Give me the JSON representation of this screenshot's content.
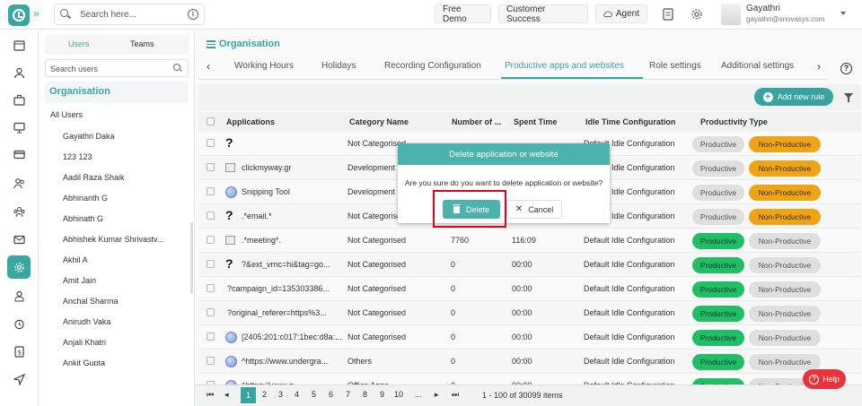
{
  "topbar": {
    "search_placeholder": "Search here...",
    "buttons": [
      "Free Demo",
      "Customer Success",
      "Agent"
    ],
    "user_name": "Gayathri",
    "user_email": "gayathri@snovasys.com"
  },
  "rail": {
    "icons": [
      "calendar-icon",
      "user-icon",
      "briefcase-icon",
      "monitor-icon",
      "card-icon",
      "users-icon",
      "team-icon",
      "mail-icon",
      "settings-icon",
      "person-icon",
      "alarm-icon",
      "invoice-icon",
      "send-icon"
    ],
    "active_index": 8
  },
  "user_panel": {
    "tabs": [
      "Users",
      "Teams"
    ],
    "active_tab": "Users",
    "search_placeholder": "Search users",
    "org_title": "Organisation",
    "all_users": "All Users",
    "users": [
      "Gayathri Daka",
      "123 123",
      "Aadil Raza Shaik",
      "Abhinanth G",
      "Abhinath G",
      "Abhishek Kumar Shrivastv...",
      "Akhil A",
      "Amit Jain",
      "Anchal Sharma",
      "Anirudh Vaka",
      "Anjali Khatri",
      "Ankit Gupta"
    ]
  },
  "main": {
    "page_title": "Organisation",
    "tabs": [
      "Working Hours",
      "Holidays",
      "Recording Configuration",
      "Productive apps and websites",
      "Role settings",
      "Additional settings"
    ],
    "active_tab": "Productive apps and websites",
    "add_rule_label": "Add new rule",
    "columns": [
      "Applications",
      "Category Name",
      "Number of ...",
      "Spent Time",
      "Idle Time Configuration",
      "Productivity Type"
    ],
    "rows": [
      {
        "icon": "question",
        "name": "",
        "category": "Not Categorised",
        "number": "",
        "spent": "",
        "idle": "Default Idle Configuration",
        "type": "non-productive"
      },
      {
        "icon": "image",
        "name": "clickmyway.gr",
        "category": "Development",
        "number": "",
        "spent": "",
        "idle": "Default Idle Configuration",
        "type": "non-productive"
      },
      {
        "icon": "globe",
        "name": "Snipping Tool",
        "category": "Development",
        "number": "",
        "spent": "",
        "idle": "Default Idle Configuration",
        "type": "non-productive"
      },
      {
        "icon": "question",
        "name": ".*email.*",
        "category": "Not Categorised",
        "number": "",
        "spent": "",
        "idle": "Default Idle Configuration",
        "type": "non-productive"
      },
      {
        "icon": "image",
        "name": ".*meeting*.",
        "category": "Not Categorised",
        "number": "7760",
        "spent": "116:09",
        "idle": "Default Idle Configuration",
        "type": "productive"
      },
      {
        "icon": "question",
        "name": "?&ext_vrnc=hi&tag=go...",
        "category": "Not Categorised",
        "number": "0",
        "spent": "00:00",
        "idle": "Default Idle Configuration",
        "type": "productive"
      },
      {
        "icon": "none",
        "name": "?campaign_id=135303386...",
        "category": "Not Categorised",
        "number": "0",
        "spent": "00:00",
        "idle": "Default Idle Configuration",
        "type": "productive"
      },
      {
        "icon": "none",
        "name": "?original_referer=https%3...",
        "category": "Not Categorised",
        "number": "0",
        "spent": "00:00",
        "idle": "Default Idle Configuration",
        "type": "productive"
      },
      {
        "icon": "globe",
        "name": "[2405:201:c017:1bec:d8a:...",
        "category": "Not Categorised",
        "number": "0",
        "spent": "00:00",
        "idle": "Default Idle Configuration",
        "type": "productive"
      },
      {
        "icon": "globe",
        "name": "^https://www.undergra...",
        "category": "Others",
        "number": "0",
        "spent": "00:00",
        "idle": "Default Idle Configuration",
        "type": "productive"
      },
      {
        "icon": "globe",
        "name": "^https://www.g...",
        "category": "Office Apps",
        "number": "0",
        "spent": "00:00",
        "idle": "Default Idle Configuration",
        "type": "productive"
      }
    ],
    "productive_label": "Productive",
    "non_productive_label": "Non-Productive"
  },
  "modal": {
    "title": "Delete application or website",
    "message": "Are you sure do you want to delete application or website?",
    "delete_label": "Delete",
    "cancel_label": "Cancel"
  },
  "pager": {
    "pages": [
      "1",
      "2",
      "3",
      "4",
      "5",
      "6",
      "7",
      "8",
      "9",
      "10",
      "..."
    ],
    "active_page": "1",
    "info": "1 - 100 of 30099 items"
  },
  "help_label": "Help",
  "colors": {
    "accent": "#3aa7a3",
    "productive": "#21c368",
    "non_productive": "#f5a815",
    "help": "#e8353b",
    "highlight": "#e0001b"
  }
}
